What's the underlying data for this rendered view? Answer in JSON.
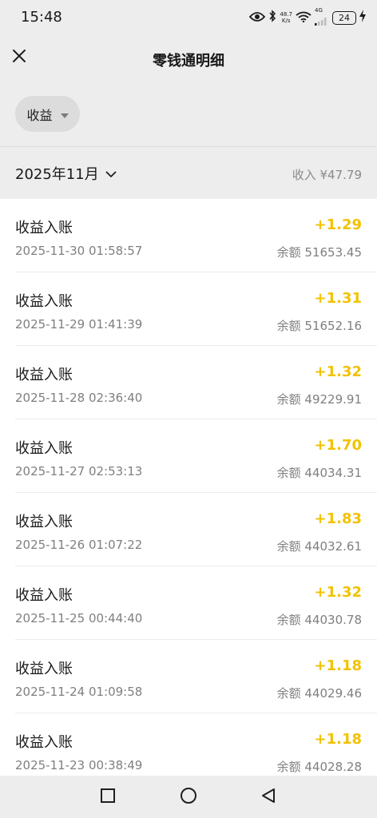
{
  "status_bar": {
    "time": "15:48",
    "net_speed_value": "48.7",
    "net_speed_unit": "K/s",
    "network_type": "4G",
    "battery": "24",
    "icons": [
      "eye-icon",
      "bluetooth-icon",
      "wifi-icon",
      "signal-icon",
      "charging-icon"
    ]
  },
  "header": {
    "title": "零钱通明细",
    "close_icon": "close-icon"
  },
  "filter": {
    "label": "收益",
    "icon": "dropdown-triangle-icon"
  },
  "month_bar": {
    "month": "2025年11月",
    "income": "收入 ¥47.79",
    "icon": "chevron-down-icon"
  },
  "transactions": [
    {
      "title": "收益入账",
      "time": "2025-11-30 01:58:57",
      "amount": "+1.29",
      "balance": "余额 51653.45"
    },
    {
      "title": "收益入账",
      "time": "2025-11-29 01:41:39",
      "amount": "+1.31",
      "balance": "余额 51652.16"
    },
    {
      "title": "收益入账",
      "time": "2025-11-28 02:36:40",
      "amount": "+1.32",
      "balance": "余额 49229.91"
    },
    {
      "title": "收益入账",
      "time": "2025-11-27 02:53:13",
      "amount": "+1.70",
      "balance": "余额 44034.31"
    },
    {
      "title": "收益入账",
      "time": "2025-11-26 01:07:22",
      "amount": "+1.83",
      "balance": "余额 44032.61"
    },
    {
      "title": "收益入账",
      "time": "2025-11-25 00:44:40",
      "amount": "+1.32",
      "balance": "余额 44030.78"
    },
    {
      "title": "收益入账",
      "time": "2025-11-24 01:09:58",
      "amount": "+1.18",
      "balance": "余额 44029.46"
    },
    {
      "title": "收益入账",
      "time": "2025-11-23 00:38:49",
      "amount": "+1.18",
      "balance": "余额 44028.28"
    }
  ],
  "colors": {
    "amount": "#f2c200",
    "background": "#ededed",
    "list_background": "#ffffff",
    "secondary_text": "#7f7f7f"
  },
  "nav_bar": {
    "icons": [
      "recent-apps-icon",
      "home-icon",
      "back-icon"
    ]
  }
}
